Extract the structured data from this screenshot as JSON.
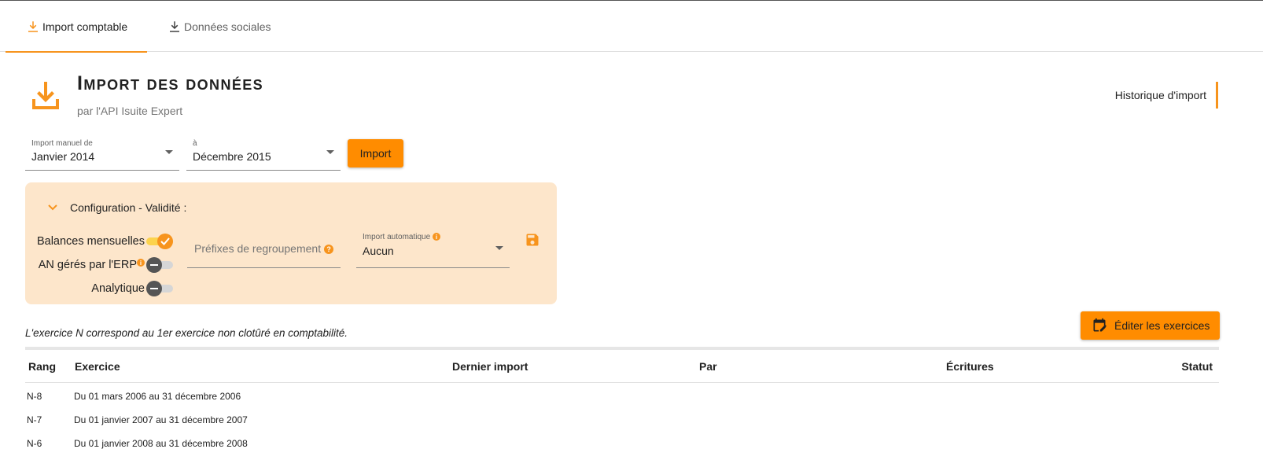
{
  "tabs": [
    {
      "label": "Import comptable",
      "icon": "download-icon",
      "active": true
    },
    {
      "label": "Données sociales",
      "icon": "download-icon",
      "active": false
    }
  ],
  "header": {
    "title": "Import des données",
    "subtitle": "par l'API Isuite Expert",
    "history_link": "Historique d'import",
    "icon": "download-icon"
  },
  "import_form": {
    "from_label": "Import manuel de",
    "from_value": "Janvier 2014",
    "to_label": "à",
    "to_value": "Décembre 2015",
    "import_button": "Import"
  },
  "config": {
    "title": "Configuration - Validité :",
    "toggles": [
      {
        "label": "Balances mensuelles",
        "on": true,
        "info": false
      },
      {
        "label": "AN gérés par l'ERP",
        "on": false,
        "info": true
      },
      {
        "label": "Analytique",
        "on": false,
        "info": false
      }
    ],
    "prefix_placeholder": "Préfixes de regroupement",
    "auto_import_label": "Import automatique",
    "auto_import_value": "Aucun",
    "info_glyph": "i",
    "help_glyph": "?"
  },
  "note": "L'exercice N correspond au 1er exercice non clotûré en comptabilité.",
  "edit_button": "Éditer les exercices",
  "table": {
    "headers": {
      "rang": "Rang",
      "exercice": "Exercice",
      "dernier_import": "Dernier import",
      "par": "Par",
      "ecritures": "Écritures",
      "statut": "Statut"
    },
    "rows": [
      {
        "rang": "N-8",
        "exercice": "Du 01 mars 2006 au 31 décembre 2006"
      },
      {
        "rang": "N-7",
        "exercice": "Du 01 janvier 2007 au 31 décembre 2007"
      },
      {
        "rang": "N-6",
        "exercice": "Du 01 janvier 2008 au 31 décembre 2008"
      }
    ]
  },
  "colors": {
    "accent": "#f7941d",
    "button": "#ff8c00",
    "panel": "#fde6cb"
  }
}
